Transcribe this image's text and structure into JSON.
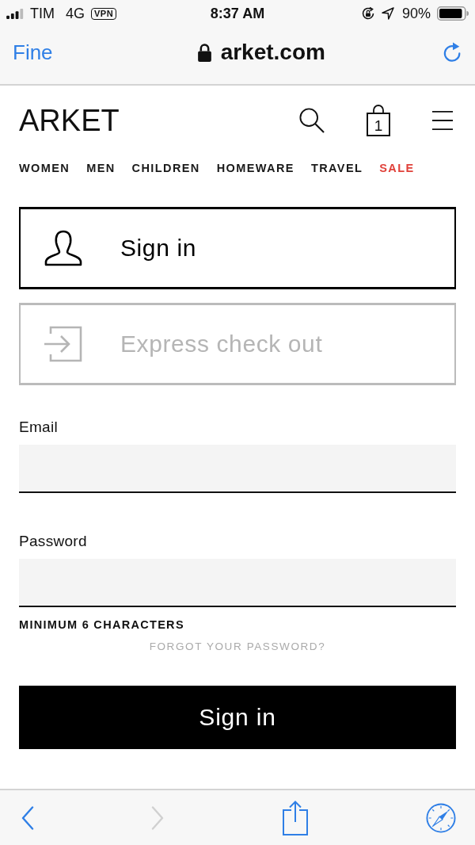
{
  "status_bar": {
    "carrier": "TIM",
    "network": "4G",
    "vpn": "VPN",
    "time": "8:37 AM",
    "battery": "90%"
  },
  "browser_bar": {
    "done": "Fine",
    "url": "arket.com"
  },
  "header": {
    "logo": "ARKET",
    "cart_count": "1"
  },
  "nav": [
    {
      "label": "WOMEN",
      "kind": "regular"
    },
    {
      "label": "MEN",
      "kind": "regular"
    },
    {
      "label": "CHILDREN",
      "kind": "regular"
    },
    {
      "label": "HOMEWARE",
      "kind": "regular"
    },
    {
      "label": "TRAVEL",
      "kind": "regular"
    },
    {
      "label": "SALE",
      "kind": "sale"
    }
  ],
  "auth_options": [
    {
      "label": "Sign in",
      "kind": "person",
      "selected": true
    },
    {
      "label": "Express check out",
      "kind": "enter",
      "selected": false
    }
  ],
  "form": {
    "fields": [
      {
        "label": "Email"
      },
      {
        "label": "Password"
      }
    ],
    "hint": "MINIMUM 6 CHARACTERS",
    "forgot_link": "FORGOT YOUR PASSWORD?",
    "submit": "Sign in"
  },
  "toolbar": [
    {
      "kind": "back",
      "disabled": false
    },
    {
      "kind": "forward",
      "disabled": true
    },
    {
      "kind": "share",
      "disabled": false
    },
    {
      "kind": "compass",
      "disabled": false
    }
  ]
}
